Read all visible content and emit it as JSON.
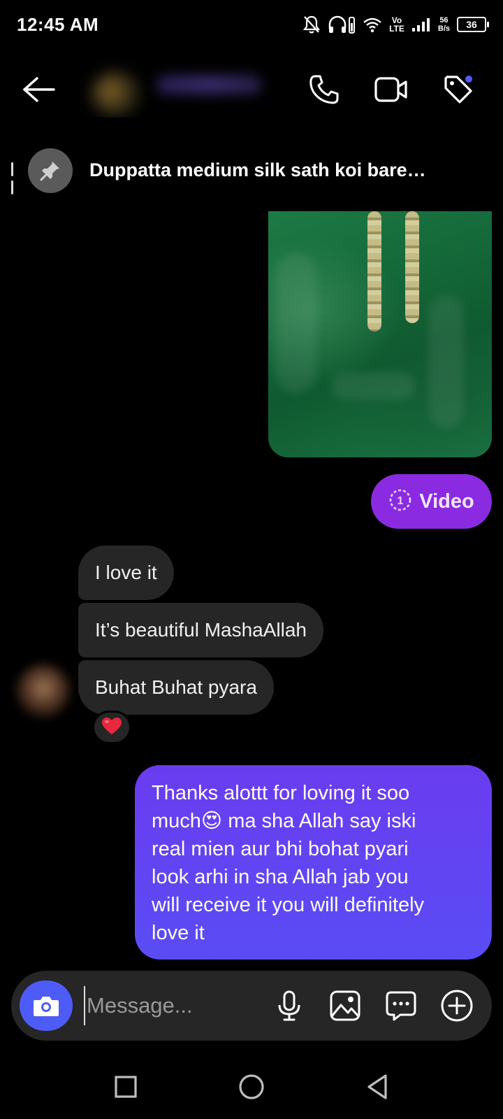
{
  "status_bar": {
    "time": "12:45 AM",
    "network_type": "Vo LTE",
    "volte_top": "Vo",
    "volte_bottom": "LTE",
    "net_speed_value": "56",
    "net_speed_unit": "B/s",
    "battery_level": "36",
    "icons": [
      "notifications-off-icon",
      "headphones-icon",
      "wifi-icon",
      "signal-icon",
      "battery-icon"
    ]
  },
  "header": {
    "back_icon": "arrow-left-icon",
    "call_icon": "phone-icon",
    "video_icon": "video-camera-icon",
    "tag_icon": "tag-icon",
    "tag_has_notification": true
  },
  "pinned": {
    "icon": "pin-icon",
    "text": "Duppatta medium silk sath koi bare…"
  },
  "messages": {
    "video_pill": {
      "icon": "view-once-icon",
      "label": "Video"
    },
    "incoming": [
      {
        "text": "I love it"
      },
      {
        "text": "It’s beautiful MashaAllah"
      },
      {
        "text": "Buhat Buhat pyara"
      }
    ],
    "reaction": "❤️",
    "outgoing_text": {
      "line_1": "Thanks alottt  for loving it soo",
      "line_2_before_emoji": "much",
      "emoji": "😍",
      "line_2_after_emoji": " ma sha Allah say iski",
      "line_3": "real mien aur bhi bohat pyari",
      "line_4": "look arhi in sha Allah jab you",
      "line_5": "will receive it you will definitely",
      "line_6": "love it"
    }
  },
  "composer": {
    "placeholder": "Message...",
    "value": "",
    "icons": [
      "camera-icon",
      "microphone-icon",
      "gallery-icon",
      "sticker-icon",
      "plus-circle-icon"
    ],
    "accent_color": "#4d5cf7"
  },
  "nav_bar": {
    "icons": [
      "recent-apps-icon",
      "home-icon",
      "back-icon"
    ]
  },
  "colors": {
    "background": "#000000",
    "incoming_bubble": "#262626",
    "outgoing_bubble_top": "#6a3cf0",
    "outgoing_bubble_bottom": "#5a4cf5",
    "video_pill": "#8a2be2",
    "notification_dot": "#4f5bff"
  }
}
